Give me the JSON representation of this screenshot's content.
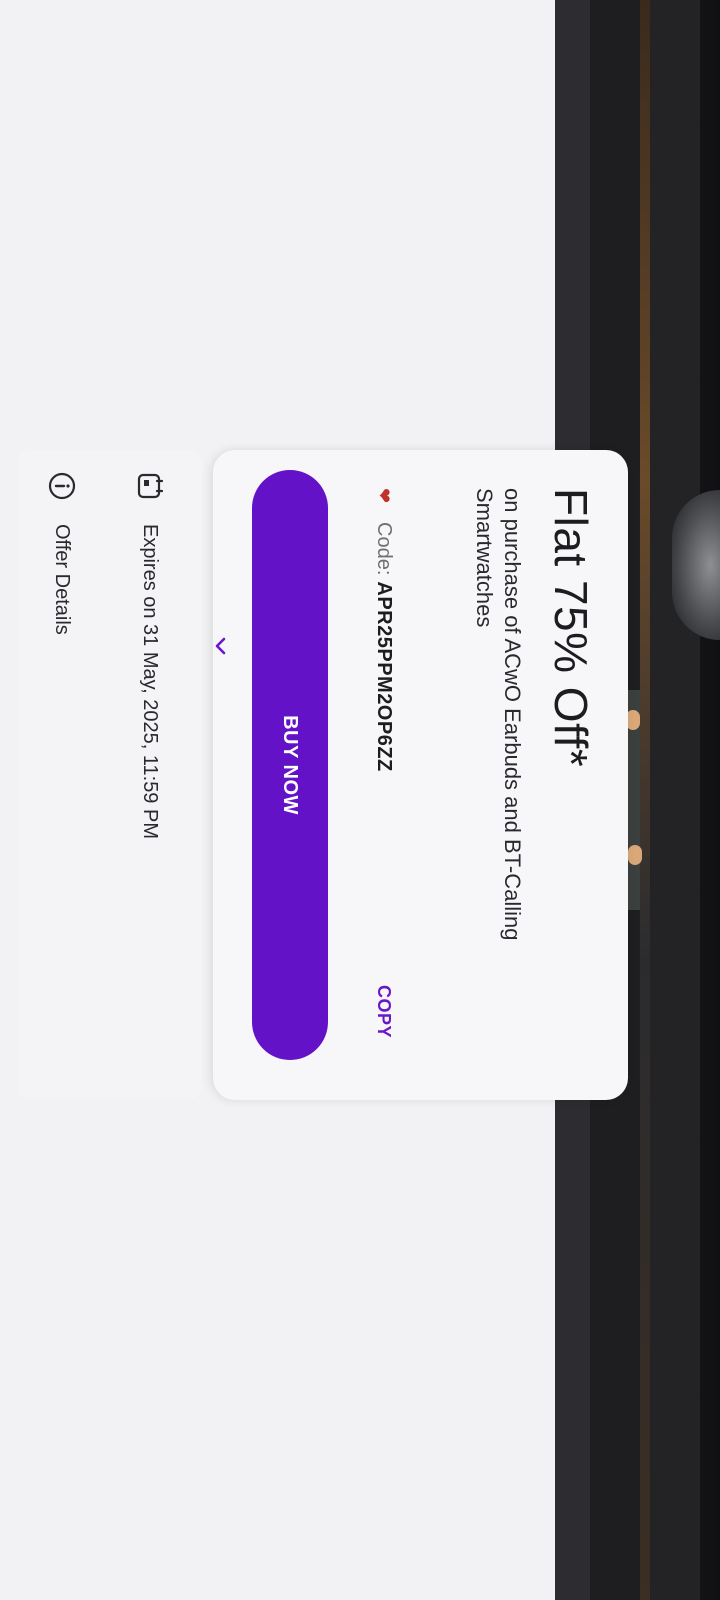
{
  "offer": {
    "title": "Flat 75% Off*",
    "subtitle": "on purchase of ACwO Earbuds and BT-Calling Smartwatches",
    "code_label": "Code:",
    "code_value": "APR25PPM2OP6ZZ",
    "copy_label": "COPY",
    "buy_label": "BUY NOW"
  },
  "info": {
    "expiry": "Expires on 31 May, 2025, 11:59 PM",
    "details_label": "Offer Details"
  },
  "icons": {
    "code": "heart-icon",
    "expiry": "calendar-icon",
    "details": "info-icon",
    "details_action": "chevron-right-icon"
  },
  "colors": {
    "accent": "#6412c8",
    "copy": "#6a16c9",
    "heart": "#c0332a",
    "background": "#f2f1f4"
  }
}
